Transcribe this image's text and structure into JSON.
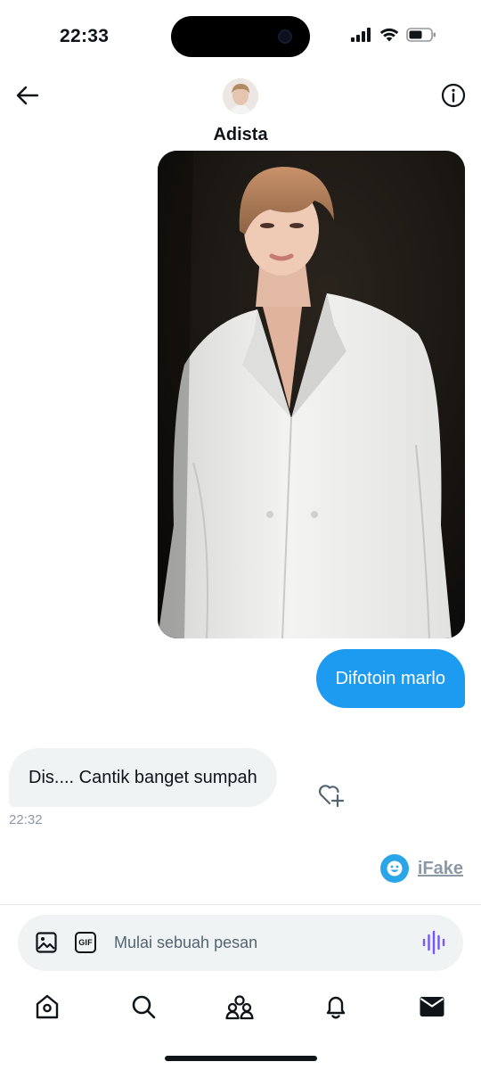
{
  "status_bar": {
    "time": "22:33",
    "icons": [
      "cellular-signal-icon",
      "wifi-icon",
      "battery-icon"
    ]
  },
  "header": {
    "contact_name": "Adista",
    "back_icon": "arrow-left-icon",
    "info_icon": "info-icon"
  },
  "messages": [
    {
      "type": "image",
      "direction": "outgoing",
      "description_icon": "photo-message"
    },
    {
      "type": "text",
      "direction": "outgoing",
      "text": "Difotoin marlo"
    },
    {
      "type": "text",
      "direction": "incoming",
      "text": "Dis.... Cantik banget sumpah",
      "time": "22:32"
    }
  ],
  "watermark": {
    "text": "iFake"
  },
  "composer": {
    "placeholder": "Mulai sebuah pesan",
    "gif_label": "GIF",
    "icons": [
      "image-icon",
      "gif-icon",
      "voice-waveform-icon"
    ]
  },
  "tabbar": {
    "items": [
      "home-icon",
      "search-icon",
      "communities-icon",
      "notifications-icon",
      "messages-icon"
    ]
  },
  "colors": {
    "accent": "#1d9bf0",
    "incoming_bubble": "#eff3f4",
    "text_primary": "#0f1419",
    "text_secondary": "#8b98a5",
    "voice_icon": "#7856ff"
  }
}
